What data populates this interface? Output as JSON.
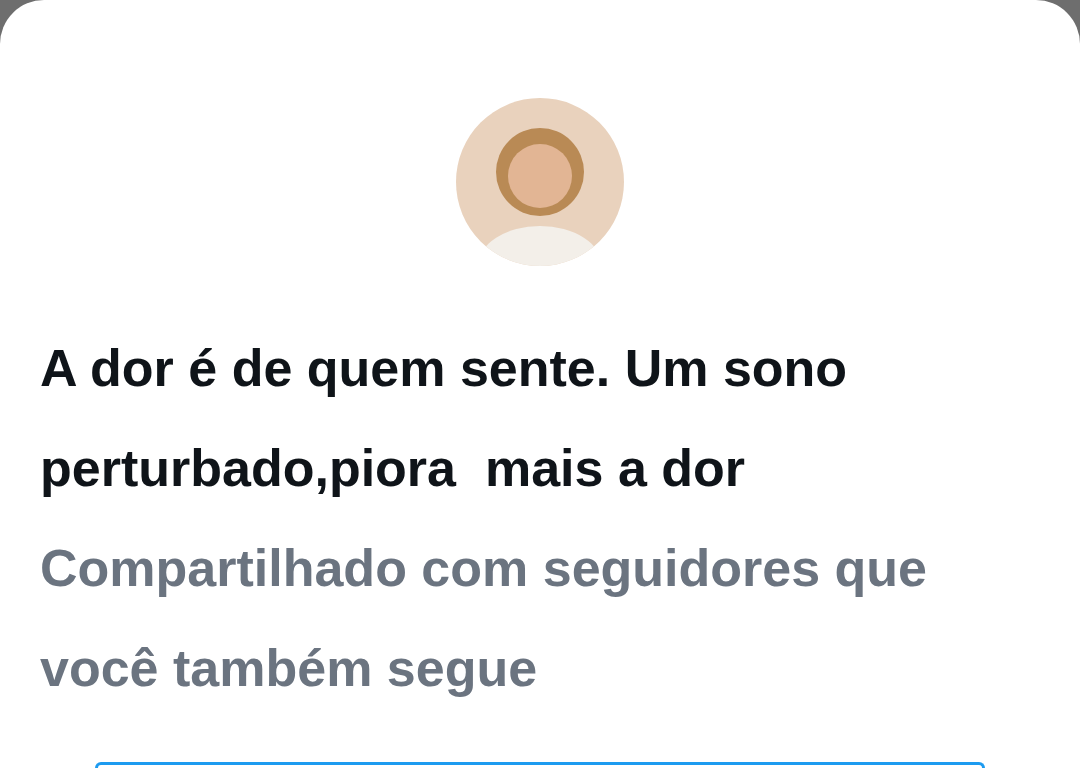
{
  "post": {
    "message": "A dor é de quem sente. Um sono perturbado,piora  mais a dor",
    "context": "Compartilhado com seguidores que você também segue"
  }
}
